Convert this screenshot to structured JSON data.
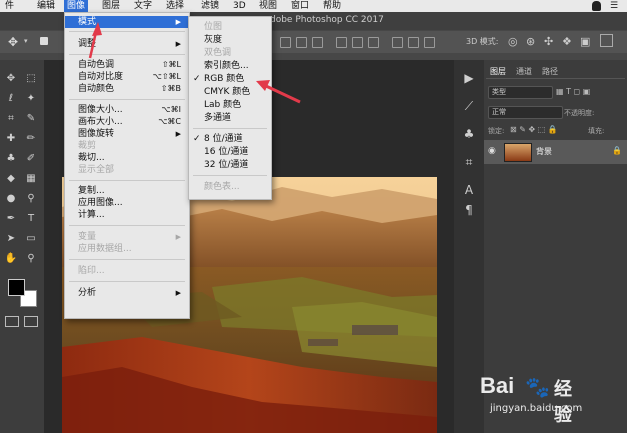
{
  "menubar": {
    "items": [
      {
        "label": "件"
      },
      {
        "label": "编辑"
      },
      {
        "label": "图像"
      },
      {
        "label": "图层"
      },
      {
        "label": "文字"
      },
      {
        "label": "选择"
      },
      {
        "label": "滤镜"
      },
      {
        "label": "3D"
      },
      {
        "label": "视图"
      },
      {
        "label": "窗口"
      },
      {
        "label": "帮助"
      }
    ],
    "active": "图像"
  },
  "window": {
    "title": "dobe Photoshop CC 2017"
  },
  "options": {
    "mode_3d": "3D 模式:"
  },
  "image_menu": {
    "items": [
      {
        "label": "模式",
        "arrow": "▶"
      },
      {
        "label": "调整",
        "arrow": "▶"
      },
      {
        "label": "自动色调",
        "shortcut": "⇧⌘L"
      },
      {
        "label": "自动对比度",
        "shortcut": "⌥⇧⌘L"
      },
      {
        "label": "自动颜色",
        "shortcut": "⇧⌘B"
      },
      {
        "label": "图像大小...",
        "shortcut": "⌥⌘I"
      },
      {
        "label": "画布大小...",
        "shortcut": "⌥⌘C"
      },
      {
        "label": "图像旋转",
        "arrow": "▶"
      },
      {
        "label": "裁剪"
      },
      {
        "label": "裁切..."
      },
      {
        "label": "显示全部"
      },
      {
        "label": "复制..."
      },
      {
        "label": "应用图像..."
      },
      {
        "label": "计算..."
      },
      {
        "label": "变量",
        "arrow": "▶"
      },
      {
        "label": "应用数据组..."
      },
      {
        "label": "陷印..."
      },
      {
        "label": "分析",
        "arrow": "▶"
      }
    ]
  },
  "mode_submenu": {
    "items": [
      {
        "label": "位图"
      },
      {
        "label": "灰度"
      },
      {
        "label": "双色调"
      },
      {
        "label": "索引颜色..."
      },
      {
        "label": "RGB 颜色",
        "check": "✓"
      },
      {
        "label": "CMYK 颜色"
      },
      {
        "label": "Lab 颜色"
      },
      {
        "label": "多通道"
      },
      {
        "label": "8 位/通道",
        "check": "✓"
      },
      {
        "label": "16 位/通道"
      },
      {
        "label": "32 位/通道"
      },
      {
        "label": "颜色表..."
      }
    ]
  },
  "panel": {
    "tabs": [
      "图层",
      "通道",
      "路径"
    ],
    "kind_filter": "类型",
    "blend_mode": "正常",
    "opacity_label": "不透明度:",
    "lock_label": "锁定:",
    "fill_label": "填充:",
    "layer_name": "背景"
  },
  "watermark": {
    "brand": "Bai",
    "brand2": "经验",
    "url": "jingyan.baidu.com"
  },
  "colors": {
    "accent": "#2f6fd6",
    "menu_bg": "#e8e8e8",
    "annotation_arrow": "#e23a4a"
  }
}
